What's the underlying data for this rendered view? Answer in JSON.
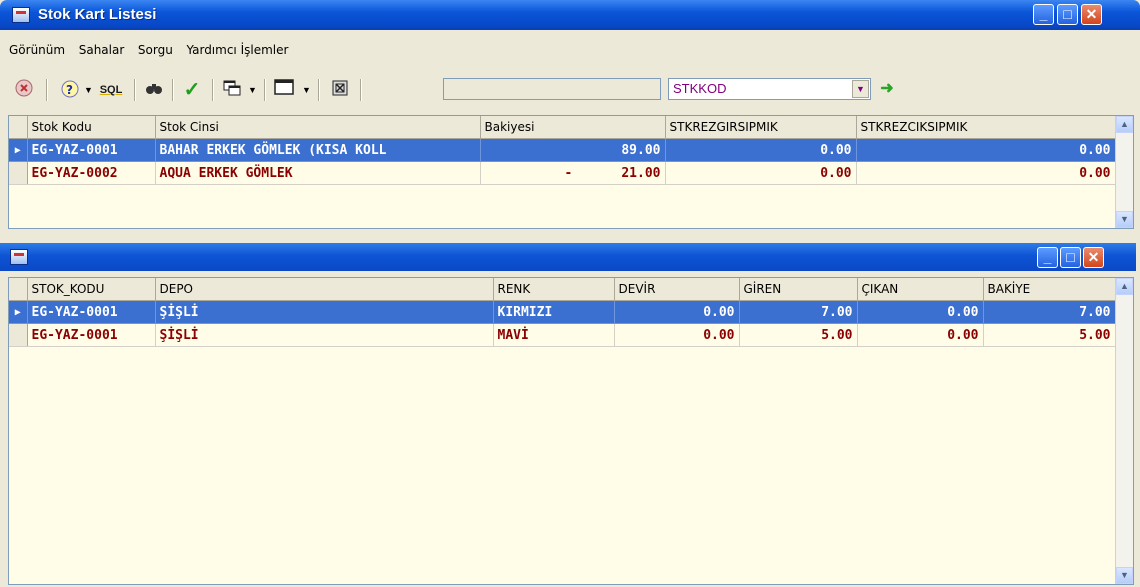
{
  "main_window": {
    "title": "Stok Kart Listesi",
    "minimize_label": "_",
    "maximize_label": "□",
    "close_label": "✕",
    "menu": [
      "Görünüm",
      "Sahalar",
      "Sorgu",
      "Yardımcı İşlemler"
    ],
    "toolbar": {
      "stop_icon": "stop-icon",
      "help_icon": "help-icon",
      "sql_label": "SQL",
      "find_icon": "binoculars-icon",
      "check_icon": "check-icon",
      "filter_value": "",
      "field_select": "STKKOD",
      "go_icon": "green-arrow-icon"
    },
    "grid": {
      "columns": [
        "Stok Kodu",
        "Stok Cinsi",
        "Bakiyesi",
        "STKREZGIRSIPMIK",
        "STKREZCIKSIPMIK"
      ],
      "rows": [
        {
          "code": "EG-YAZ-0001",
          "name": "BAHAR ERKEK GÖMLEK  (KISA KOLL",
          "sign": "",
          "balance": "89.00",
          "rez_in": "0.00",
          "rez_out": "0.00",
          "selected": true
        },
        {
          "code": "EG-YAZ-0002",
          "name": "AQUA ERKEK GÖMLEK",
          "sign": "-",
          "balance": "21.00",
          "rez_in": "0.00",
          "rez_out": "0.00",
          "selected": false
        }
      ]
    }
  },
  "sub_window": {
    "title": "",
    "grid": {
      "columns": [
        "STOK_KODU",
        "DEPO",
        "RENK",
        "DEVİR",
        "GİREN",
        "ÇIKAN",
        "BAKİYE"
      ],
      "rows": [
        {
          "code": "EG-YAZ-0001",
          "depo": "ŞİŞLİ",
          "renk": "KIRMIZI",
          "devir": "0.00",
          "giren": "7.00",
          "cikan": "0.00",
          "bakiye": "7.00",
          "selected": true
        },
        {
          "code": "EG-YAZ-0001",
          "depo": "ŞİŞLİ",
          "renk": "MAVİ",
          "devir": "0.00",
          "giren": "5.00",
          "cikan": "0.00",
          "bakiye": "5.00",
          "selected": false
        }
      ]
    }
  },
  "colors": {
    "title_blue": "#0a56d8",
    "selection": "#3b6fd0",
    "row_text": "#8b0000",
    "grid_bg": "#fffde8"
  }
}
